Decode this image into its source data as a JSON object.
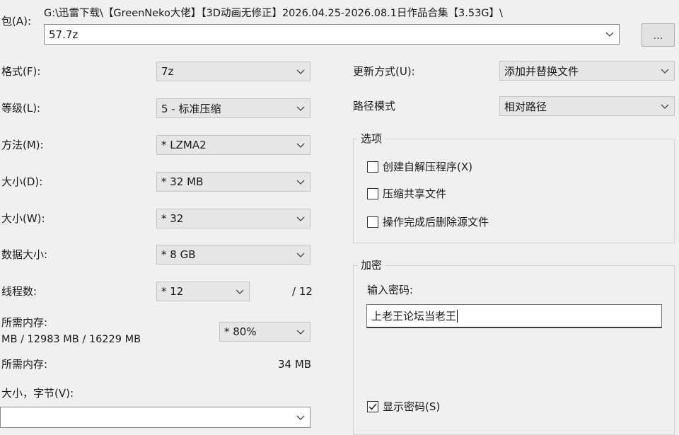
{
  "archive": {
    "label": "包(A):",
    "path": "G:\\迅雷下载\\【GreenNeko大佬】【3D动画无修正】2026.04.25-2026.08.1日作品合集【3.53G】\\",
    "name": "57.7z",
    "browse_label": "..."
  },
  "left": {
    "format": {
      "label": "格式(F):",
      "value": "7z"
    },
    "level": {
      "label": "等级(L):",
      "value": "5 - 标准压缩"
    },
    "method": {
      "label": "方法(M):",
      "value": "* LZMA2"
    },
    "dict_size": {
      "label": "大小(D):",
      "value": "* 32 MB"
    },
    "word_size": {
      "label": "大小(W):",
      "value": "* 32"
    },
    "solid_size": {
      "label": "数据大小:",
      "value": "* 8 GB"
    },
    "threads": {
      "label": "线程数:",
      "value": "* 12",
      "max": "/ 12"
    },
    "mem_compress": {
      "label": "所需内存:",
      "detail": "MB / 12983 MB / 16229 MB",
      "value": "* 80%"
    },
    "mem_decompress": {
      "label": "所需内存:",
      "value": "34 MB"
    },
    "split": {
      "label": "大小，字节(V):",
      "value": ""
    }
  },
  "right": {
    "update_mode": {
      "label": "更新方式(U):",
      "value": "添加并替换文件"
    },
    "path_mode": {
      "label": "路径模式",
      "value": "相对路径"
    },
    "options": {
      "title": "选项",
      "items": [
        {
          "label": "创建自解压程序(X)",
          "checked": false
        },
        {
          "label": "压缩共享文件",
          "checked": false
        },
        {
          "label": "操作完成后删除源文件",
          "checked": false
        }
      ]
    },
    "encryption": {
      "title": "加密",
      "password_label": "输入密码:",
      "password_value": "上老王论坛当老王",
      "show_password_label": "显示密码(S)",
      "show_password_checked": true
    }
  }
}
